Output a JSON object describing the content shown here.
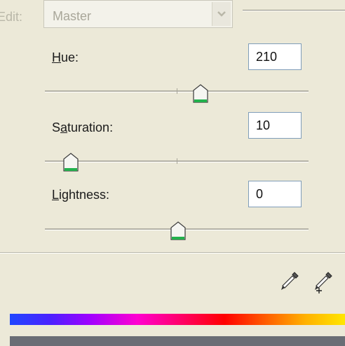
{
  "edit": {
    "label": "Edit:",
    "selected": "Master"
  },
  "hue": {
    "label_pre": "",
    "label_key": "H",
    "label_post": "ue:",
    "value": "210"
  },
  "saturation": {
    "label_pre": "S",
    "label_key": "a",
    "label_post": "turation:",
    "value": "10"
  },
  "lightness": {
    "label_pre": "",
    "label_key": "L",
    "label_post": "ightness:",
    "value": "0"
  },
  "icons": {
    "eyedropper": "eyedropper-icon",
    "eyedropper_add": "eyedropper-plus-icon",
    "dropdown": "chevron-down-icon"
  },
  "colors": {
    "background": "#ece9d8",
    "field_border": "#7f9db9",
    "thumb_accent": "#22b14c",
    "spectrum_start": "#1f46ff",
    "spectrum_end": "#ffe600"
  }
}
